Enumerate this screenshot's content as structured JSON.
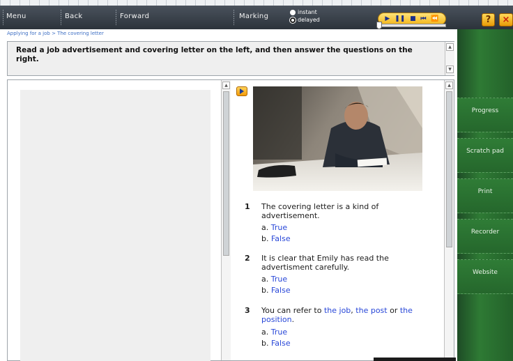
{
  "toolbar": {
    "menu_label": "Menu",
    "back_label": "Back",
    "forward_label": "Forward",
    "marking_label": "Marking",
    "marking_options": [
      {
        "label": "instant",
        "selected": false
      },
      {
        "label": "delayed",
        "selected": true
      }
    ],
    "player_controls": [
      "play-icon",
      "pause-icon",
      "stop-icon",
      "skip-back-icon",
      "rewind-icon"
    ],
    "help_label": "?",
    "close_label": "×"
  },
  "breadcrumb": "Applying for a job > The covering letter",
  "instruction": "Read a job advertisement and covering letter on the left, and then answer the questions on the right.",
  "questions": [
    {
      "number": "1",
      "text": "The covering letter is a kind of advertisement.",
      "options": [
        {
          "letter": "a.",
          "label": "True"
        },
        {
          "letter": "b.",
          "label": "False"
        }
      ]
    },
    {
      "number": "2",
      "text": "It is clear that Emily has read the advertisment carefully.",
      "options": [
        {
          "letter": "a.",
          "label": "True"
        },
        {
          "letter": "b.",
          "label": "False"
        }
      ]
    },
    {
      "number": "3",
      "text_parts": [
        "You can refer to ",
        "the job",
        ", ",
        "the post",
        " or ",
        "the position",
        "."
      ],
      "options": [
        {
          "letter": "a.",
          "label": "True"
        },
        {
          "letter": "b.",
          "label": "False"
        }
      ]
    }
  ],
  "sidebar": {
    "items": [
      {
        "label": "Progress"
      },
      {
        "label": "Scratch pad"
      },
      {
        "label": "Print"
      },
      {
        "label": "Recorder"
      },
      {
        "label": "Website"
      }
    ]
  },
  "colors": {
    "toolbar": "#2c333b",
    "sidebar": "#2e7a34",
    "link": "#2847d8",
    "player": "#f2b61c"
  }
}
